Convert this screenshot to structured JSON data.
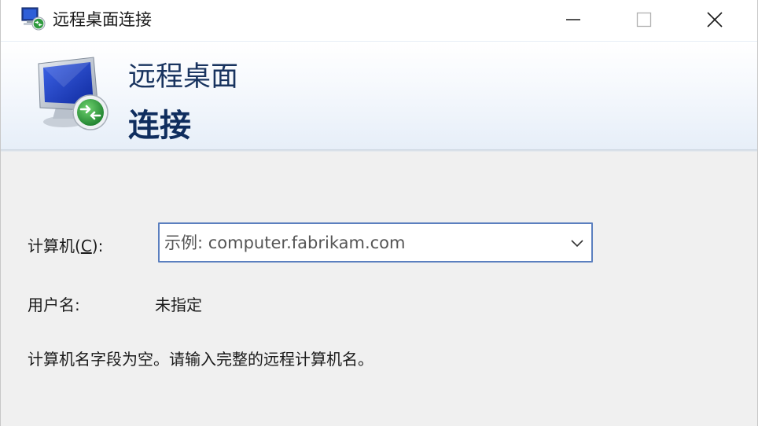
{
  "window": {
    "title": "远程桌面连接",
    "icons": {
      "app": "remote-desktop-icon",
      "minimize": "minimize-icon",
      "maximize": "maximize-icon",
      "close": "close-icon"
    }
  },
  "banner": {
    "line1": "远程桌面",
    "line2": "连接",
    "icon": "remote-desktop-monitor-icon"
  },
  "form": {
    "computer": {
      "label_prefix": "计算机(",
      "label_accel": "C",
      "label_suffix": "):",
      "value": "",
      "placeholder": "示例: computer.fabrikam.com",
      "dropdown_icon": "chevron-down-icon"
    },
    "username": {
      "label": "用户名:",
      "value": "未指定"
    },
    "message": "计算机名字段为空。请输入完整的远程计算机名。"
  },
  "colors": {
    "banner_text": "#18335f",
    "input_border": "#5b7fbf",
    "window_bg": "#f0f0f0"
  }
}
